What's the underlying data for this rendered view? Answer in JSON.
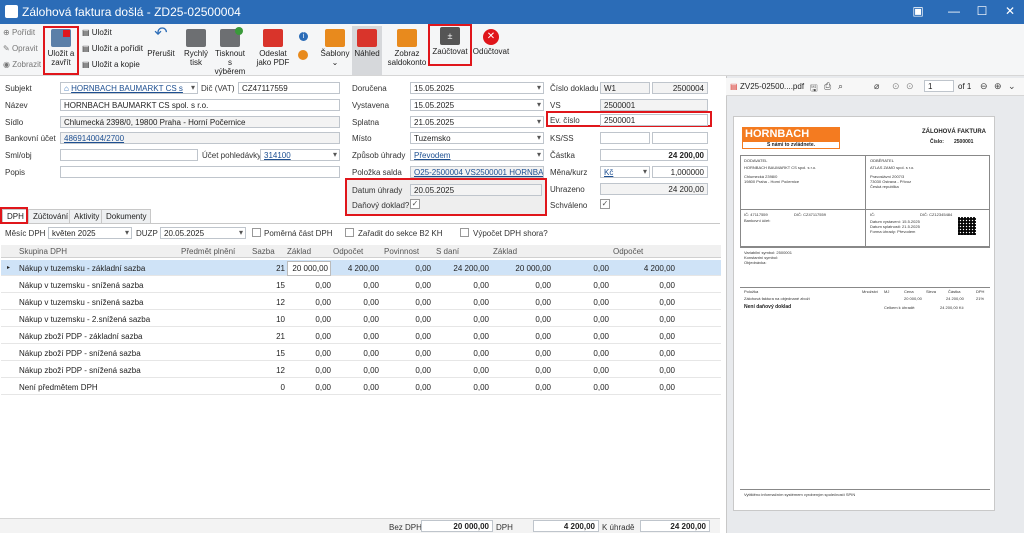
{
  "window": {
    "title": "Zálohová faktura došlá - ZD25-02500004"
  },
  "ribbon": {
    "left_small": [
      "Pořídit",
      "Opravit",
      "Zobrazit"
    ],
    "save_close": "Uložit a zavřít",
    "save": "Uložit",
    "save_new": "Uložit a pořídit",
    "save_copy": "Uložit a kopie",
    "recalc": "Přerušit",
    "quick_print": "Rychlý tisk",
    "print_sel": "Tisknout s výběrem",
    "send_pdf": "Odeslat jako PDF",
    "templates": "Šablony",
    "preview": "Náhled",
    "show_saldo": "Zobraz saldokonto",
    "post": "Zaúčtovat",
    "unpost": "Odúčtovat"
  },
  "form": {
    "subjekt_label": "Subjekt",
    "subjekt": "HORNBACH BAUMARKT CS s",
    "dic_label": "Dič (VAT)",
    "dic": "CZ47117559",
    "nazev_label": "Název",
    "nazev": "HORNBACH BAUMARKT CS spol. s r.o.",
    "sidlo_label": "Sídlo",
    "sidlo": "Chlumecká 2398/0, 19800 Praha - Horní Počernice",
    "ucet_label": "Bankovní účet",
    "ucet": "486914004/2700",
    "smlobj_label": "Sml/obj",
    "ucet_pohl_label": "Účet pohledávky",
    "ucet_pohl": "314100",
    "popis_label": "Popis",
    "dorucena_label": "Doručena",
    "dorucena": "15.05.2025",
    "vystavena_label": "Vystavena",
    "vystavena": "15.05.2025",
    "splatna_label": "Splatna",
    "splatna": "21.05.2025",
    "misto_label": "Místo",
    "misto": "Tuzemsko",
    "zpusob_label": "Způsob úhrady",
    "zpusob": "Převodem",
    "saldo_label": "Položka salda",
    "saldo": "O25-2500004 VS2500001 HORNBACH I",
    "datum_uhr_label": "Datum úhrady",
    "datum_uhr": "20.05.2025",
    "danovy_label": "Daňový doklad?",
    "cislo_label": "Číslo dokladu",
    "cislo_series": "W1",
    "cislo": "2500004",
    "vs_label": "VS",
    "vs": "2500001",
    "ev_label": "Ev. číslo",
    "ev": "2500001",
    "ksss_label": "KS/SS",
    "castka_label": "Částka",
    "castka": "24 200,00",
    "mena_label": "Měna/kurz",
    "mena": "Kč",
    "kurz": "1,000000",
    "uhrazeno_label": "Uhrazeno",
    "uhrazeno": "24 200,00",
    "schvaleno_label": "Schváleno"
  },
  "tabs": [
    "DPH",
    "Zúčtování",
    "Aktivity",
    "Dokumenty"
  ],
  "dph": {
    "mesic_label": "Měsíc DPH",
    "mesic": "květen 2025",
    "duzp_label": "DUZP",
    "duzp": "20.05.2025",
    "pomerna": "Poměrná část DPH",
    "zaradit": "Zařadit do sekce B2 KH",
    "vypocet": "Výpočet DPH shora?"
  },
  "table": {
    "headers": [
      "Skupina DPH",
      "Předmět plnění",
      "Sazba",
      "Základ",
      "Odpočet",
      "Povinnost",
      "S daní",
      "Základ",
      "Odpočet"
    ],
    "rows": [
      [
        "Nákup v tuzemsku - základní sazba",
        "",
        "21",
        "20 000,00",
        "4 200,00",
        "0,00",
        "24 200,00",
        "20 000,00",
        "0,00",
        "4 200,00"
      ],
      [
        "Nákup v tuzemsku - snížená sazba",
        "",
        "15",
        "0,00",
        "0,00",
        "0,00",
        "0,00",
        "0,00",
        "0,00",
        "0,00"
      ],
      [
        "Nákup v tuzemsku - snížená sazba",
        "",
        "12",
        "0,00",
        "0,00",
        "0,00",
        "0,00",
        "0,00",
        "0,00",
        "0,00"
      ],
      [
        "Nákup v tuzemsku - 2.snížená sazba",
        "",
        "10",
        "0,00",
        "0,00",
        "0,00",
        "0,00",
        "0,00",
        "0,00",
        "0,00"
      ],
      [
        "Nákup zboží PDP - základní sazba",
        "",
        "21",
        "0,00",
        "0,00",
        "0,00",
        "0,00",
        "0,00",
        "0,00",
        "0,00"
      ],
      [
        "Nákup zboží PDP - snížená sazba",
        "",
        "15",
        "0,00",
        "0,00",
        "0,00",
        "0,00",
        "0,00",
        "0,00",
        "0,00"
      ],
      [
        "Nákup zboží PDP - snížená sazba",
        "",
        "12",
        "0,00",
        "0,00",
        "0,00",
        "0,00",
        "0,00",
        "0,00",
        "0,00"
      ],
      [
        "Není předmětem DPH",
        "",
        "0",
        "0,00",
        "0,00",
        "0,00",
        "0,00",
        "0,00",
        "0,00",
        "0,00"
      ]
    ]
  },
  "footer": {
    "bez_label": "Bez DPH",
    "bez": "20 000,00",
    "dph_label": "DPH",
    "dph": "4 200,00",
    "uhrade_label": "K úhradě",
    "uhrade": "24 200,00"
  },
  "pdf": {
    "filename": "ZV25-02500....pdf",
    "page": "1",
    "of": "of 1",
    "brand": "HORNBACH",
    "slogan": "S námi to zvládnete.",
    "doc_title": "ZÁLOHOVÁ FAKTURA",
    "doc_no_label": "Číslo:",
    "doc_no": "2500001",
    "supplier_label": "DODAVATEL",
    "supplier": "HORNBACH BAUMARKT CS spol. s r.o.",
    "supplier_addr1": "Chlumecká 2398/0",
    "supplier_addr2": "19800 Praha - Horní Počernice",
    "customer_label": "ODBĚRATEL",
    "customer": "ATLAS ZAMO spol. s r.o.",
    "customer_addr1": "Pravoslávní 2007/3",
    "customer_addr2": "73030 Ostrava - Přívoz",
    "customer_country": "Česká republika",
    "ic_label": "IČ:",
    "ic": "47117559",
    "dic_label": "DIČ:",
    "dic": "CZ47117559",
    "bank_label": "Bankovní účet:",
    "cust_ic": "IČ:",
    "cust_dic": "DIČ: CZ12345484",
    "date_issue_label": "Datum vystavení:",
    "date_issue": "15.5.2025",
    "date_due_label": "Datum splatnosti:",
    "date_due": "21.5.2025",
    "pay_label": "Forma úhrady:",
    "pay": "Převodem",
    "vs_label": "Variabilní symbol:",
    "vs": "2500001",
    "ks_label": "Konstantní symbol:",
    "obj_label": "Objednávka:",
    "item_hdr": [
      "Položka",
      "Množství",
      "MJ",
      "Cena",
      "Sleva",
      "Částka",
      "DPH"
    ],
    "item_line": "Zálohová faktura na objednané zboží",
    "item_amount": "20 000,00",
    "item_total": "24 200,00",
    "item_vat": "21%",
    "sum_label": "Není daňový doklad",
    "sum_total_label": "Celkem k úhradě:",
    "sum_total": "24 200,00 Kč",
    "footer_text": "Vytištěno informačním systémem vyrobeným společností SPIN"
  },
  "colors": {
    "accent": "#2b6cb7",
    "highlight": "#e0161b",
    "row_selected": "#cfe3f7",
    "brand": "#f47b20"
  }
}
